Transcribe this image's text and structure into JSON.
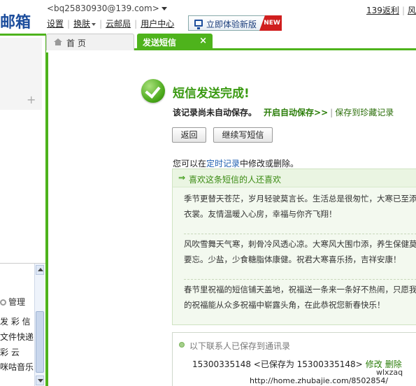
{
  "header": {
    "logo_text": "邮箱",
    "account_email": "<bq25830930@139.com>",
    "menu": [
      "设置",
      "换肤",
      "云邮局",
      "用户中心"
    ],
    "new_version_btn": "立即体验新版",
    "new_badge": "NEW",
    "top_links": [
      "139返利",
      "风"
    ]
  },
  "tabs": {
    "home": "首 页",
    "sms": "发送短信",
    "close": "×"
  },
  "left_panel": {
    "plus": "+",
    "manage": "管理",
    "items": [
      "发 彩 信",
      "文件快递",
      "彩    云",
      "咪咕音乐"
    ]
  },
  "result": {
    "title": "短信发送完成!",
    "not_saved": "该记录尚未自动保存。",
    "enable_autosave": "开启自动保存>>",
    "separator": "|",
    "save_to_favorites": "保存到珍藏记录",
    "back_btn": "返回",
    "continue_btn": "继续写短信",
    "modify_prefix": "您可以在",
    "modify_link": "定时记录",
    "modify_suffix": "中修改或删除。"
  },
  "recommend": {
    "arrow": "⇒",
    "title": "喜欢这条短信的人还喜欢",
    "messages": [
      "季节更替天苍茫，岁月轻驶莫言长。生活总是很匆忙，大寒已至添衣裳。友情温暖入心房，幸福与你齐飞翔！",
      "风吹雪舞天气寒，刺骨冷风透心凉。大寒风大围巾添，养生保健莫要忘。少盐，少食糖脂体康健。祝君大寒喜乐扬，吉祥安康！",
      "春节里祝福的短信铺天盖地，祝福送一条来一条好不热闹，只愿我的祝福能从众多祝福中崭露头角，在此恭祝您新春快乐！"
    ]
  },
  "contacts": {
    "head": "以下联系人已保存到通讯录",
    "entry": "15300335148 <已保存为 15300335148>",
    "edit": "修改",
    "delete": "删除"
  },
  "watermark": {
    "user": "wlxzaq",
    "url": "http://home.zhubajie.com/8502854/"
  }
}
